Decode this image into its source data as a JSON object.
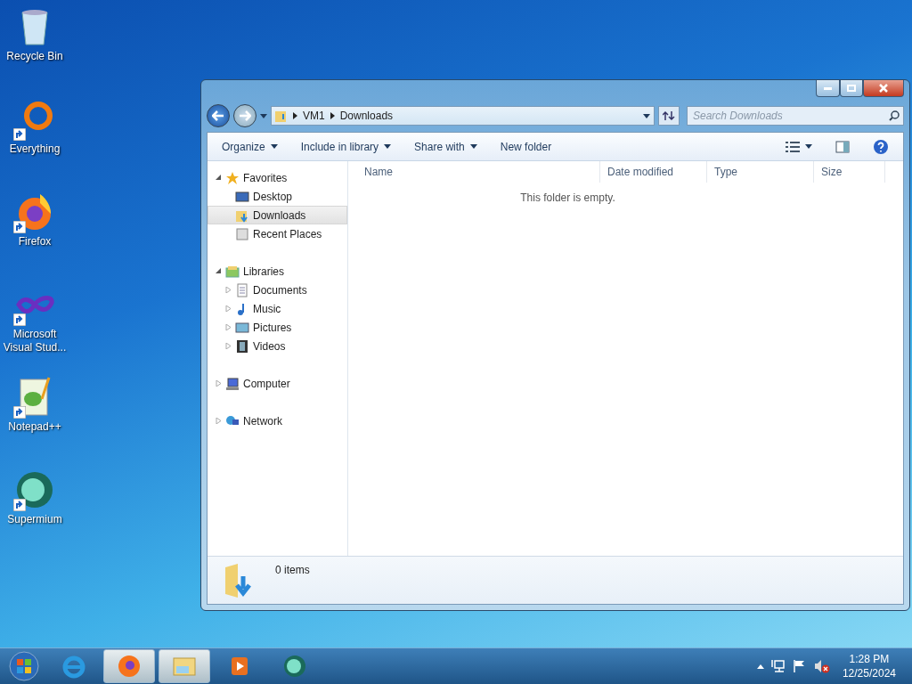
{
  "desktop_icons": [
    {
      "label": "Recycle Bin",
      "kind": "bin",
      "shortcut": false
    },
    {
      "label": "Everything",
      "kind": "ring",
      "shortcut": true
    },
    {
      "label": "Firefox",
      "kind": "fox",
      "shortcut": true
    },
    {
      "label": "Microsoft Visual Stud...",
      "kind": "infinity",
      "shortcut": true
    },
    {
      "label": "Notepad++",
      "kind": "notepad",
      "shortcut": true
    },
    {
      "label": "Supermium",
      "kind": "globe",
      "shortcut": true
    }
  ],
  "window": {
    "address": {
      "path": [
        "VM1",
        "Downloads"
      ]
    },
    "search": {
      "placeholder": "Search Downloads"
    },
    "toolbar": [
      {
        "label": "Organize",
        "dropdown": true
      },
      {
        "label": "Include in library",
        "dropdown": true
      },
      {
        "label": "Share with",
        "dropdown": true
      },
      {
        "label": "New folder",
        "dropdown": false
      }
    ],
    "nav": [
      {
        "label": "Favorites",
        "kind": "star",
        "expanded": true,
        "selected": false,
        "children": [
          {
            "label": "Desktop",
            "kind": "desktop",
            "selected": false
          },
          {
            "label": "Downloads",
            "kind": "download",
            "selected": true
          },
          {
            "label": "Recent Places",
            "kind": "recent",
            "selected": false
          }
        ]
      },
      {
        "label": "Libraries",
        "kind": "library",
        "expanded": true,
        "selected": false,
        "children": [
          {
            "label": "Documents",
            "kind": "document",
            "selected": false,
            "expanded": false
          },
          {
            "label": "Music",
            "kind": "music",
            "selected": false,
            "expanded": false
          },
          {
            "label": "Pictures",
            "kind": "picture",
            "selected": false,
            "expanded": false
          },
          {
            "label": "Videos",
            "kind": "video",
            "selected": false,
            "expanded": false
          }
        ]
      },
      {
        "label": "Computer",
        "kind": "computer",
        "expanded": false,
        "selected": false
      },
      {
        "label": "Network",
        "kind": "network",
        "expanded": false,
        "selected": false
      }
    ],
    "columns": [
      "Name",
      "Date modified",
      "Type",
      "Size"
    ],
    "empty_message": "This folder is empty.",
    "status": "0 items"
  },
  "taskbar": {
    "apps": [
      {
        "kind": "ie",
        "running": false
      },
      {
        "kind": "fox",
        "running": true
      },
      {
        "kind": "explorer",
        "running": true
      },
      {
        "kind": "player",
        "running": false
      },
      {
        "kind": "globe",
        "running": false
      }
    ],
    "time": "1:28 PM",
    "date": "12/25/2024",
    "volume_muted": true
  }
}
